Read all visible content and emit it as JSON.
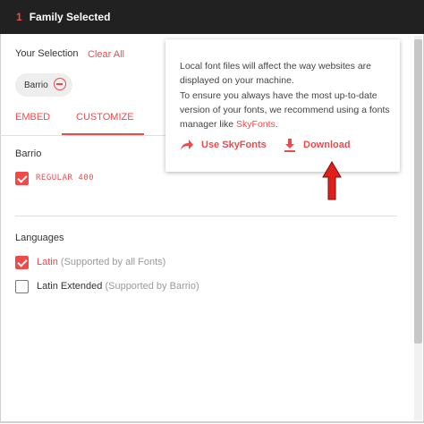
{
  "header": {
    "count": "1",
    "title": "Family Selected"
  },
  "selection": {
    "title": "Your Selection",
    "clear_label": "Clear All",
    "chip_label": "Barrio"
  },
  "tabs": [
    {
      "label": "EMBED",
      "active": false
    },
    {
      "label": "CUSTOMIZE",
      "active": true
    }
  ],
  "customize": {
    "family": "Barrio",
    "styles": [
      {
        "label": "REGULAR 400",
        "checked": true
      }
    ],
    "languages_title": "Languages",
    "languages": [
      {
        "label": "Latin",
        "note": "(Supported by all Fonts)",
        "checked": true
      },
      {
        "label": "Latin Extended",
        "note": "(Supported by Barrio)",
        "checked": false
      }
    ]
  },
  "popover": {
    "line1": "Local font files will affect the way websites are displayed on your machine.",
    "line2_pre": "To ensure you always have the most up-to-date version of your fonts, we recommend using a fonts manager like ",
    "line2_link": "SkyFonts",
    "line2_post": ".",
    "skyfonts_label": "Use SkyFonts",
    "download_label": "Download"
  },
  "colors": {
    "accent": "#ef4a4a",
    "header_bg": "#212121"
  }
}
